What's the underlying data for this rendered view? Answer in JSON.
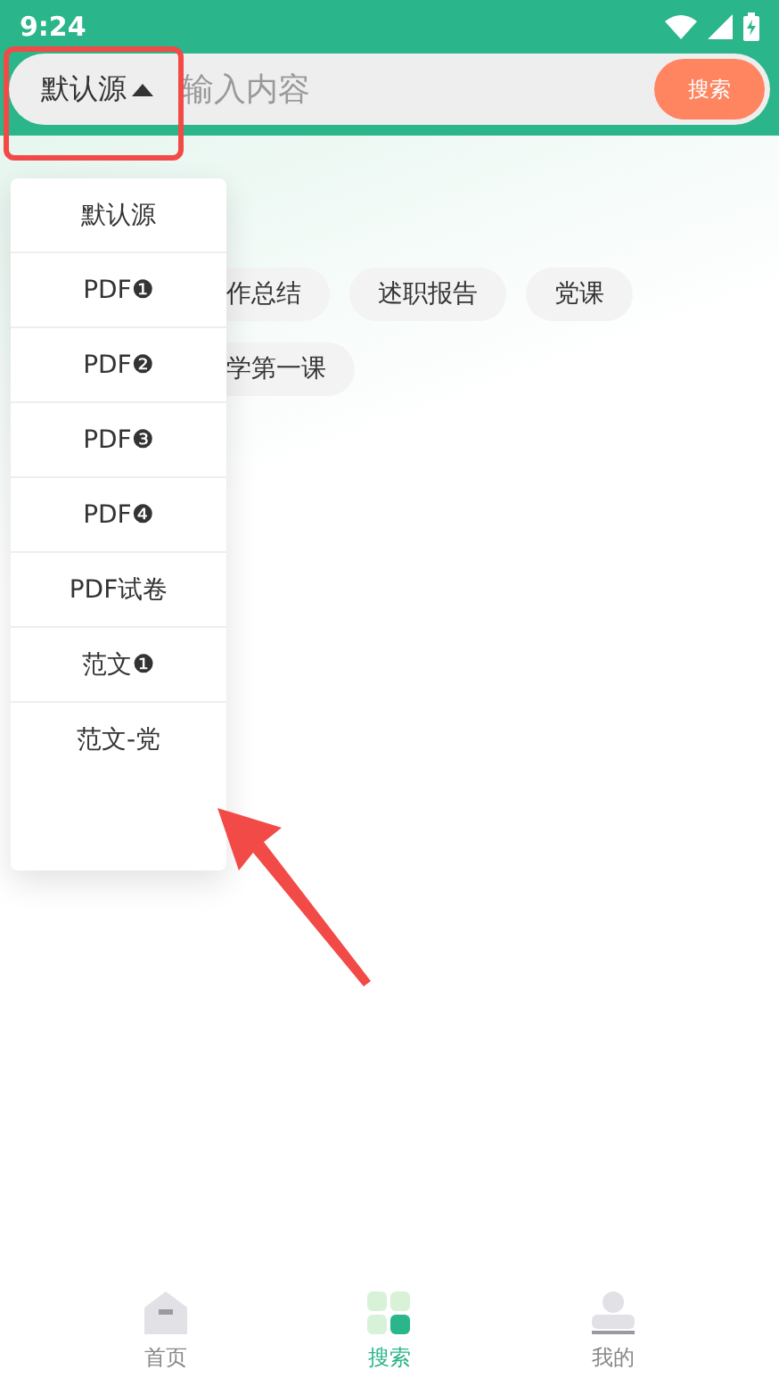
{
  "status_bar": {
    "time": "9:24"
  },
  "search_bar": {
    "source": "默认源",
    "placeholder": "输入内容",
    "button": "搜索"
  },
  "source_menu": {
    "expanded": true,
    "items": [
      {
        "label": "默认源",
        "selected": false
      },
      {
        "label": "PDF❶",
        "selected": false
      },
      {
        "label": "PDF❷",
        "selected": false
      },
      {
        "label": "PDF❸",
        "selected": false
      },
      {
        "label": "PDF❹",
        "selected": false
      },
      {
        "label": "PDF试卷",
        "selected": false
      },
      {
        "label": "范文❶",
        "selected": false
      },
      {
        "label": "范文-党",
        "selected": false
      }
    ]
  },
  "tags": [
    [
      "作总结",
      "述职报告",
      "党课"
    ],
    [
      "学第一课"
    ]
  ],
  "tab_bar": [
    {
      "label": "首页",
      "selected": false
    },
    {
      "label": "搜索",
      "selected": true
    },
    {
      "label": "我的",
      "selected": false
    }
  ]
}
